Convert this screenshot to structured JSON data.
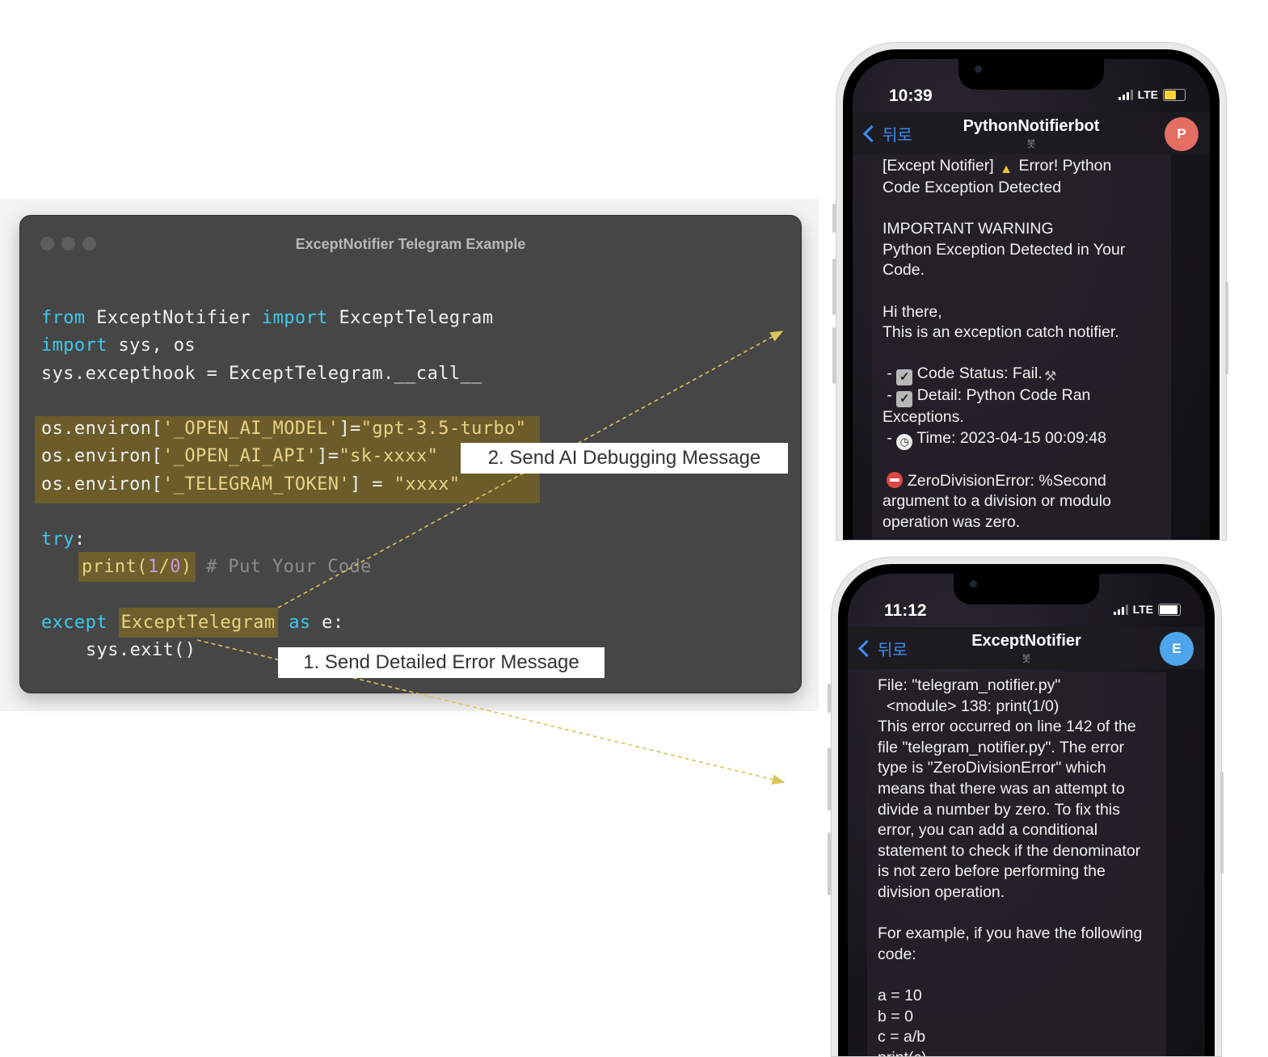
{
  "code_window": {
    "title": "ExceptNotifier Telegram Example",
    "lines": {
      "l1_kw1": "from",
      "l1_a": " ExceptNotifier ",
      "l1_kw2": "import",
      "l1_b": " ExceptTelegram",
      "l2_kw": "import",
      "l2_a": " sys, os",
      "l3": "sys.excepthook = ExceptTelegram.__call__",
      "l4_a": "os.environ[",
      "l4_s1": "'_OPEN_AI_MODEL'",
      "l4_b": "]=",
      "l4_s2": "\"gpt-3.5-turbo\"",
      "l5_a": "os.environ[",
      "l5_s1": "'_OPEN_AI_API'",
      "l5_b": "]=",
      "l5_s2": "\"sk-xxxx\"",
      "l6_a": "os.environ[",
      "l6_s1": "'_TELEGRAM_TOKEN'",
      "l6_b": "] = ",
      "l6_s2": "\"xxxx\"",
      "l7_kw": "try",
      "l7_b": ":",
      "l8_a": "print(",
      "l8_n1": "1",
      "l8_op": "/",
      "l8_n2": "0",
      "l8_b": ")",
      "l8_cmt": " # Put Your Code",
      "l9_kw1": "except",
      "l9_sp": " ",
      "l9_a": "ExceptTelegram",
      "l9_sp2": " ",
      "l9_kw2": "as",
      "l9_b": " e:",
      "l10": "sys.exit()"
    }
  },
  "callouts": {
    "ai": "2. Send AI Debugging Message",
    "error": "1. Send Detailed Error Message"
  },
  "colors": {
    "keyword": "#3ec9ee",
    "string": "#e9d386",
    "highlight": "#6b5c2a",
    "arrow": "#d8c55a",
    "telegram_blue": "#3d8df5",
    "avatar_p": "#e56e63",
    "avatar_e": "#4ea5ec"
  },
  "phone_top": {
    "time": "10:39",
    "network": "LTE",
    "back_label": "뒤로",
    "chat_title": "PythonNotifierbot",
    "chat_subtitle": "봇",
    "avatar_letter": "P",
    "message": {
      "m1a": "[Except Notifier] ",
      "m1b": " Error! Python\nCode Exception Detected\n\nIMPORTANT WARNING\nPython Exception Detected in Your\nCode.\n\nHi there,\nThis is an exception catch notifier.\n\n - ",
      "m2": " Code Status: Fail.",
      "m3": "\n - ",
      "m4": " Detail: Python Code Ran\nExceptions.\n - ",
      "m5": " Time: 2023-04-15 00:09:48\n\n ",
      "m6": " ZeroDivisionError: %Second\nargument to a division or modulo\noperation was zero."
    }
  },
  "phone_bottom": {
    "time": "11:12",
    "network": "LTE",
    "back_label": "뒤로",
    "chat_title": "ExceptNotifier",
    "chat_subtitle": "봇",
    "avatar_letter": "E",
    "message": "File: \"telegram_notifier.py\"\n  <module> 138: print(1/0)\nThis error occurred on line 142 of the\nfile \"telegram_notifier.py\". The error\ntype is \"ZeroDivisionError\" which\nmeans that there was an attempt to\ndivide a number by zero. To fix this\nerror, you can add a conditional\nstatement to check if the denominator\nis not zero before performing the\ndivision operation.\n\nFor example, if you have the following\ncode:\n\na = 10\nb = 0\nc = a/b\nprint(c)"
  },
  "icons": {
    "warning": "warning-icon",
    "check": "check-box-icon",
    "clock": "clock-icon",
    "stop": "no-entry-icon",
    "tools": "hammer-wrench-icon"
  }
}
